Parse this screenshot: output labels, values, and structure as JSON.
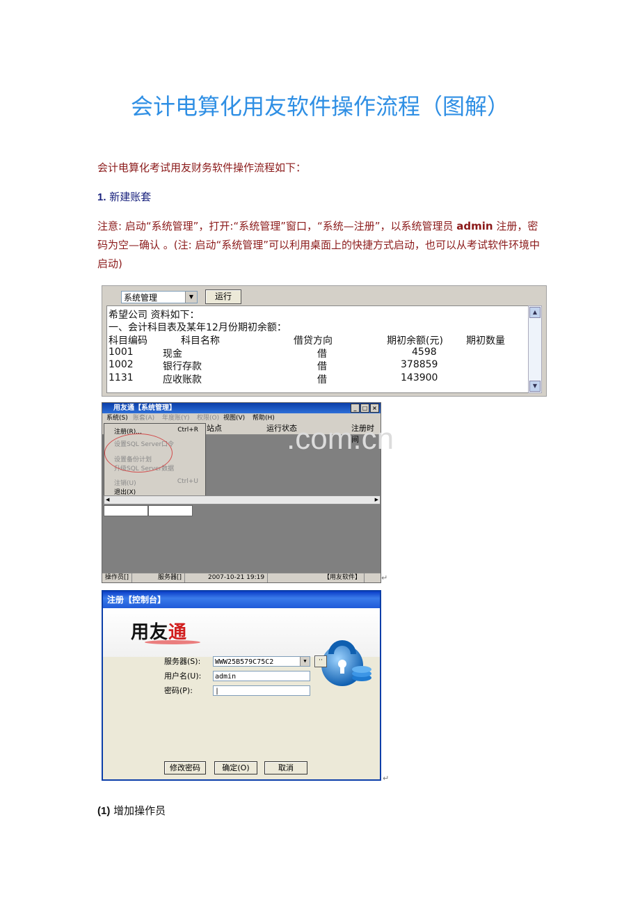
{
  "doc": {
    "title": "会计电算化用友软件操作流程（图解）",
    "intro": "会计电算化考试用友财务软件操作流程如下：",
    "section1_num": "1.",
    "section1_label": "新建账套",
    "note_part1": "注意: 启动“系统管理”，打开:“系统管理”窗口，“系统—注册”，以系统管理员 ",
    "note_admin": "admin",
    "note_part2": " 注册，密码为空—确认 。",
    "note_part3": "(注: 启动“系统管理”可以利用桌面上的快捷方式启动，也可以从考试软件环境中启动)",
    "section2_num": "(1)",
    "section2_label": "增加操作员",
    "return_mark": "↵"
  },
  "shot1": {
    "dropdown_value": "系统管理",
    "run_button": "运行",
    "lines": [
      "希望公司 资料如下：",
      "一、会计科目表及某年12月份期初余额：",
      "科目编码",
      "科目名称",
      "借贷方向",
      "期初余额(元)",
      "期初数量"
    ],
    "rows": [
      {
        "code": "1001",
        "name": "现金",
        "dir": "借",
        "amount": "4598"
      },
      {
        "code": "1002",
        "name": "银行存款",
        "dir": "借",
        "amount": "378859"
      },
      {
        "code": "1131",
        "name": "应收账款",
        "dir": "借",
        "amount": "143900"
      }
    ]
  },
  "shot2": {
    "window_title": "用友通【系统管理】",
    "menubar": [
      "系统(S)",
      "账套(A)",
      "年度账(Y)",
      "权限(O)",
      "视图(V)",
      "帮助(H)"
    ],
    "header_cols": [
      "站点",
      "运行状态",
      "注册时间"
    ],
    "menu_items": [
      {
        "label": "注册(R)...",
        "shortcut": "Ctrl+R",
        "enabled": true
      },
      {
        "label": "设置SQL Server口令",
        "shortcut": "",
        "enabled": false
      },
      {
        "label": "设置备份计划",
        "shortcut": "",
        "enabled": false
      },
      {
        "label": "升级SQL Server数据",
        "shortcut": "",
        "enabled": false
      },
      {
        "label": "注销(U)",
        "shortcut": "Ctrl+U",
        "enabled": false
      },
      {
        "label": "退出(X)",
        "shortcut": "",
        "enabled": true
      }
    ],
    "status": [
      "操作员[]",
      "服务器[]",
      "2007-10-21 19:19",
      "【用友软件】"
    ],
    "watermark": ".com.cn"
  },
  "shot3": {
    "window_title": "注册【控制台】",
    "logo_part1": "用友",
    "logo_part2": "通",
    "server_label": "服务器(S):",
    "server_value": "WWW25B579C75C2",
    "user_label": "用户名(U):",
    "user_value": "admin",
    "password_label": "密码(P):",
    "password_value": "|",
    "buttons": [
      "修改密码",
      "确定(O)",
      "取消"
    ]
  },
  "colors": {
    "title": "#2f8fe4",
    "body_red": "#8b1a1a",
    "section_blue": "#1a237e",
    "xp_title": "#0b3ea8"
  }
}
